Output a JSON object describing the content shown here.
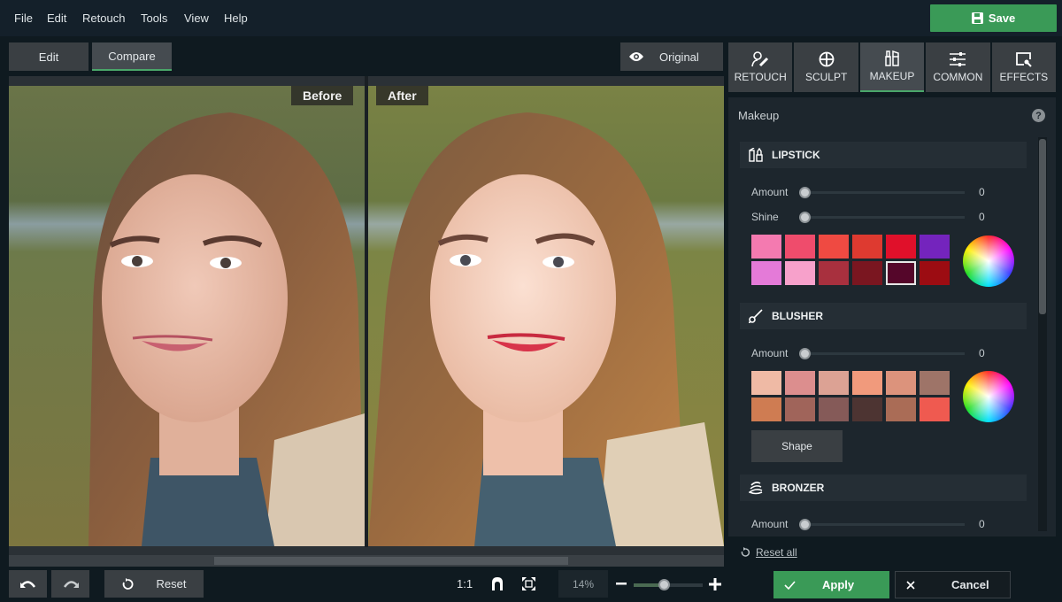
{
  "menu": [
    "File",
    "Edit",
    "Retouch",
    "Tools",
    "View",
    "Help"
  ],
  "save_label": "Save",
  "view_tabs": [
    {
      "label": "Edit",
      "active": false
    },
    {
      "label": "Compare",
      "active": true
    }
  ],
  "original_label": "Original",
  "compare": {
    "before_label": "Before",
    "after_label": "After"
  },
  "panel_tabs": [
    {
      "label": "RETOUCH",
      "icon": "retouch-icon",
      "active": false
    },
    {
      "label": "SCULPT",
      "icon": "sculpt-icon",
      "active": false
    },
    {
      "label": "MAKEUP",
      "icon": "makeup-icon",
      "active": true
    },
    {
      "label": "COMMON",
      "icon": "sliders-icon",
      "active": false
    },
    {
      "label": "EFFECTS",
      "icon": "effects-icon",
      "active": false
    }
  ],
  "panel": {
    "title": "Makeup",
    "help": "?",
    "lipstick": {
      "title": "LIPSTICK",
      "amount_label": "Amount",
      "amount_value": "0",
      "shine_label": "Shine",
      "shine_value": "0",
      "colors": [
        "#f47ab0",
        "#ef4c6c",
        "#ef4a42",
        "#de3a30",
        "#e0102a",
        "#7424bd",
        "#e47ad8",
        "#f7a1cb",
        "#a8303e",
        "#7a1620",
        "#55062a",
        "#9c0c12"
      ],
      "selected_index": 10
    },
    "blusher": {
      "title": "BLUSHER",
      "amount_label": "Amount",
      "amount_value": "0",
      "colors": [
        "#efbaa5",
        "#dc8e8e",
        "#dca294",
        "#f19a7c",
        "#dc937c",
        "#9e7468",
        "#cf7c52",
        "#a0645a",
        "#855a58",
        "#4d3432",
        "#aa6c56",
        "#ef5a50"
      ],
      "shape_label": "Shape"
    },
    "bronzer": {
      "title": "BRONZER",
      "amount_label": "Amount",
      "amount_value": "0"
    }
  },
  "reset_all_label": "Reset all",
  "apply_label": "Apply",
  "cancel_label": "Cancel",
  "bottom": {
    "reset_label": "Reset",
    "one_to_one": "1:1",
    "zoom_value": "14%"
  }
}
